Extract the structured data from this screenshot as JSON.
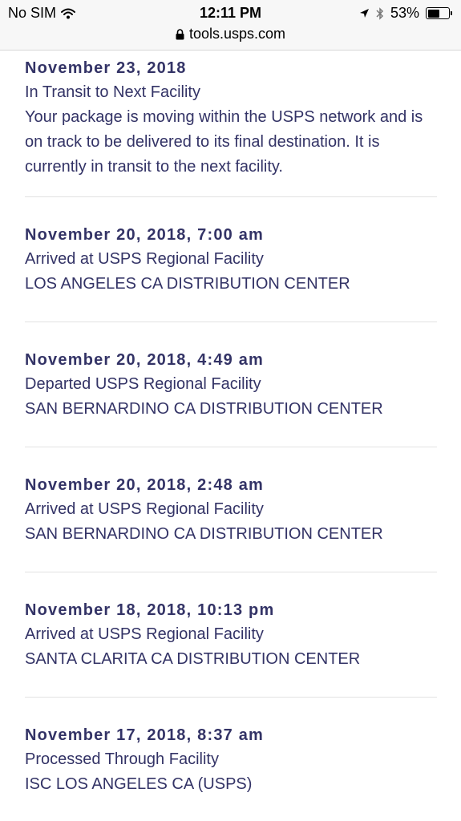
{
  "status_bar": {
    "carrier": "No SIM",
    "time": "12:11 PM",
    "battery_percent": "53%",
    "battery_level": 0.53,
    "url": "tools.usps.com"
  },
  "events": [
    {
      "date": "November 23, 2018",
      "status": "In Transit to Next Facility",
      "detail": "Your package is moving within the USPS network and is on track to be delivered to its final destination. It is currently in transit to the next facility."
    },
    {
      "date": "November 20, 2018, 7:00 am",
      "status": "Arrived at USPS Regional Facility",
      "location": "LOS ANGELES CA DISTRIBUTION CENTER"
    },
    {
      "date": "November 20, 2018, 4:49 am",
      "status": "Departed USPS Regional Facility",
      "location": "SAN BERNARDINO CA DISTRIBUTION CENTER"
    },
    {
      "date": "November 20, 2018, 2:48 am",
      "status": "Arrived at USPS Regional Facility",
      "location": "SAN BERNARDINO CA DISTRIBUTION CENTER"
    },
    {
      "date": "November 18, 2018, 10:13 pm",
      "status": "Arrived at USPS Regional Facility",
      "location": "SANTA CLARITA CA DISTRIBUTION CENTER"
    },
    {
      "date": "November 17, 2018, 8:37 am",
      "status": "Processed Through Facility",
      "location": "ISC LOS ANGELES CA (USPS)"
    }
  ],
  "colors": {
    "text": "#333366",
    "divider": "#e2e2e2",
    "statusbar_bg": "#f7f7f7"
  }
}
